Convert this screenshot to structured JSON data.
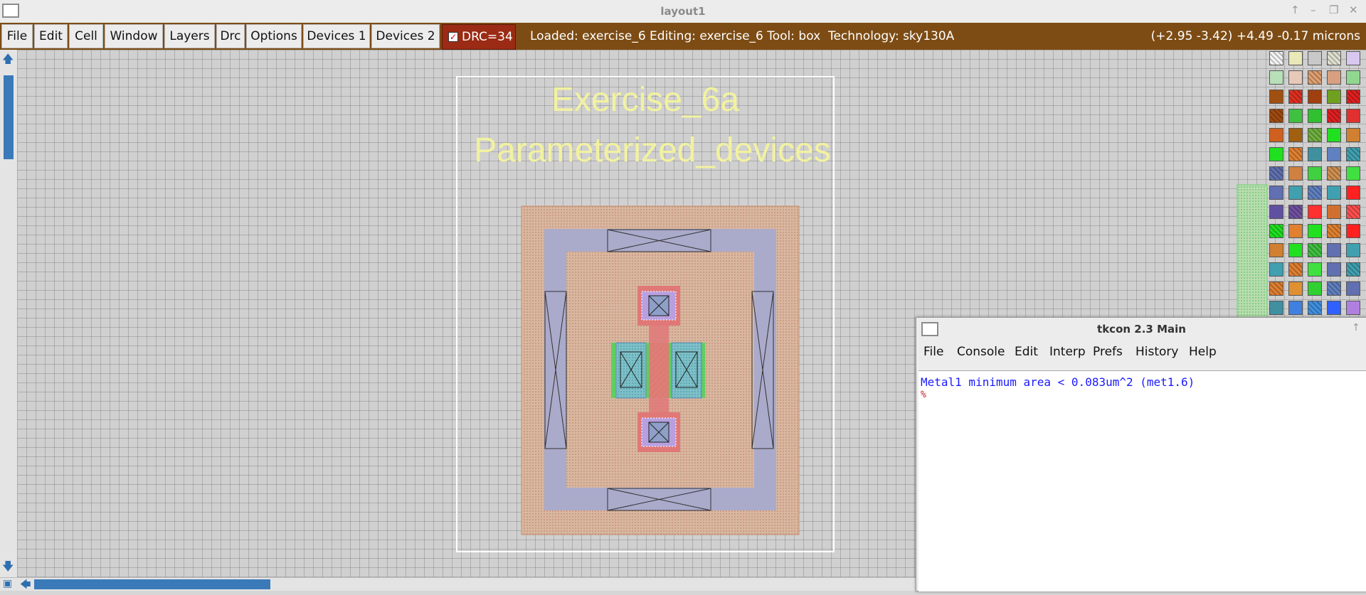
{
  "window": {
    "title": "layout1"
  },
  "menubar": {
    "items": [
      "File",
      "Edit",
      "Cell",
      "Window",
      "Layers",
      "Drc",
      "Options",
      "Devices 1",
      "Devices 2"
    ],
    "drc_label": "DRC=34",
    "status": "Loaded: exercise_6 Editing: exercise_6 Tool: box  Technology: sky130A",
    "coordinates": "(+2.95 -3.42) +4.49 -0.17 microns"
  },
  "layout": {
    "title_line1": "Exercise_6a",
    "title_line2": "Parameterized_devices"
  },
  "colors": {
    "menubar_bg": "#7d4c14",
    "drc_bg": "#9b2b14",
    "label_text": "#f2f2a0",
    "tk_message": "#1a1aff",
    "tk_prompt": "#c02020"
  },
  "tkcon": {
    "title": "tkcon 2.3 Main",
    "menu": [
      "File",
      "Console",
      "Edit",
      "Interp",
      "Prefs",
      "History",
      "Help"
    ],
    "output_line": "Metal1 minimum area < 0.083um^2 (met1.6)",
    "prompt": "%"
  }
}
